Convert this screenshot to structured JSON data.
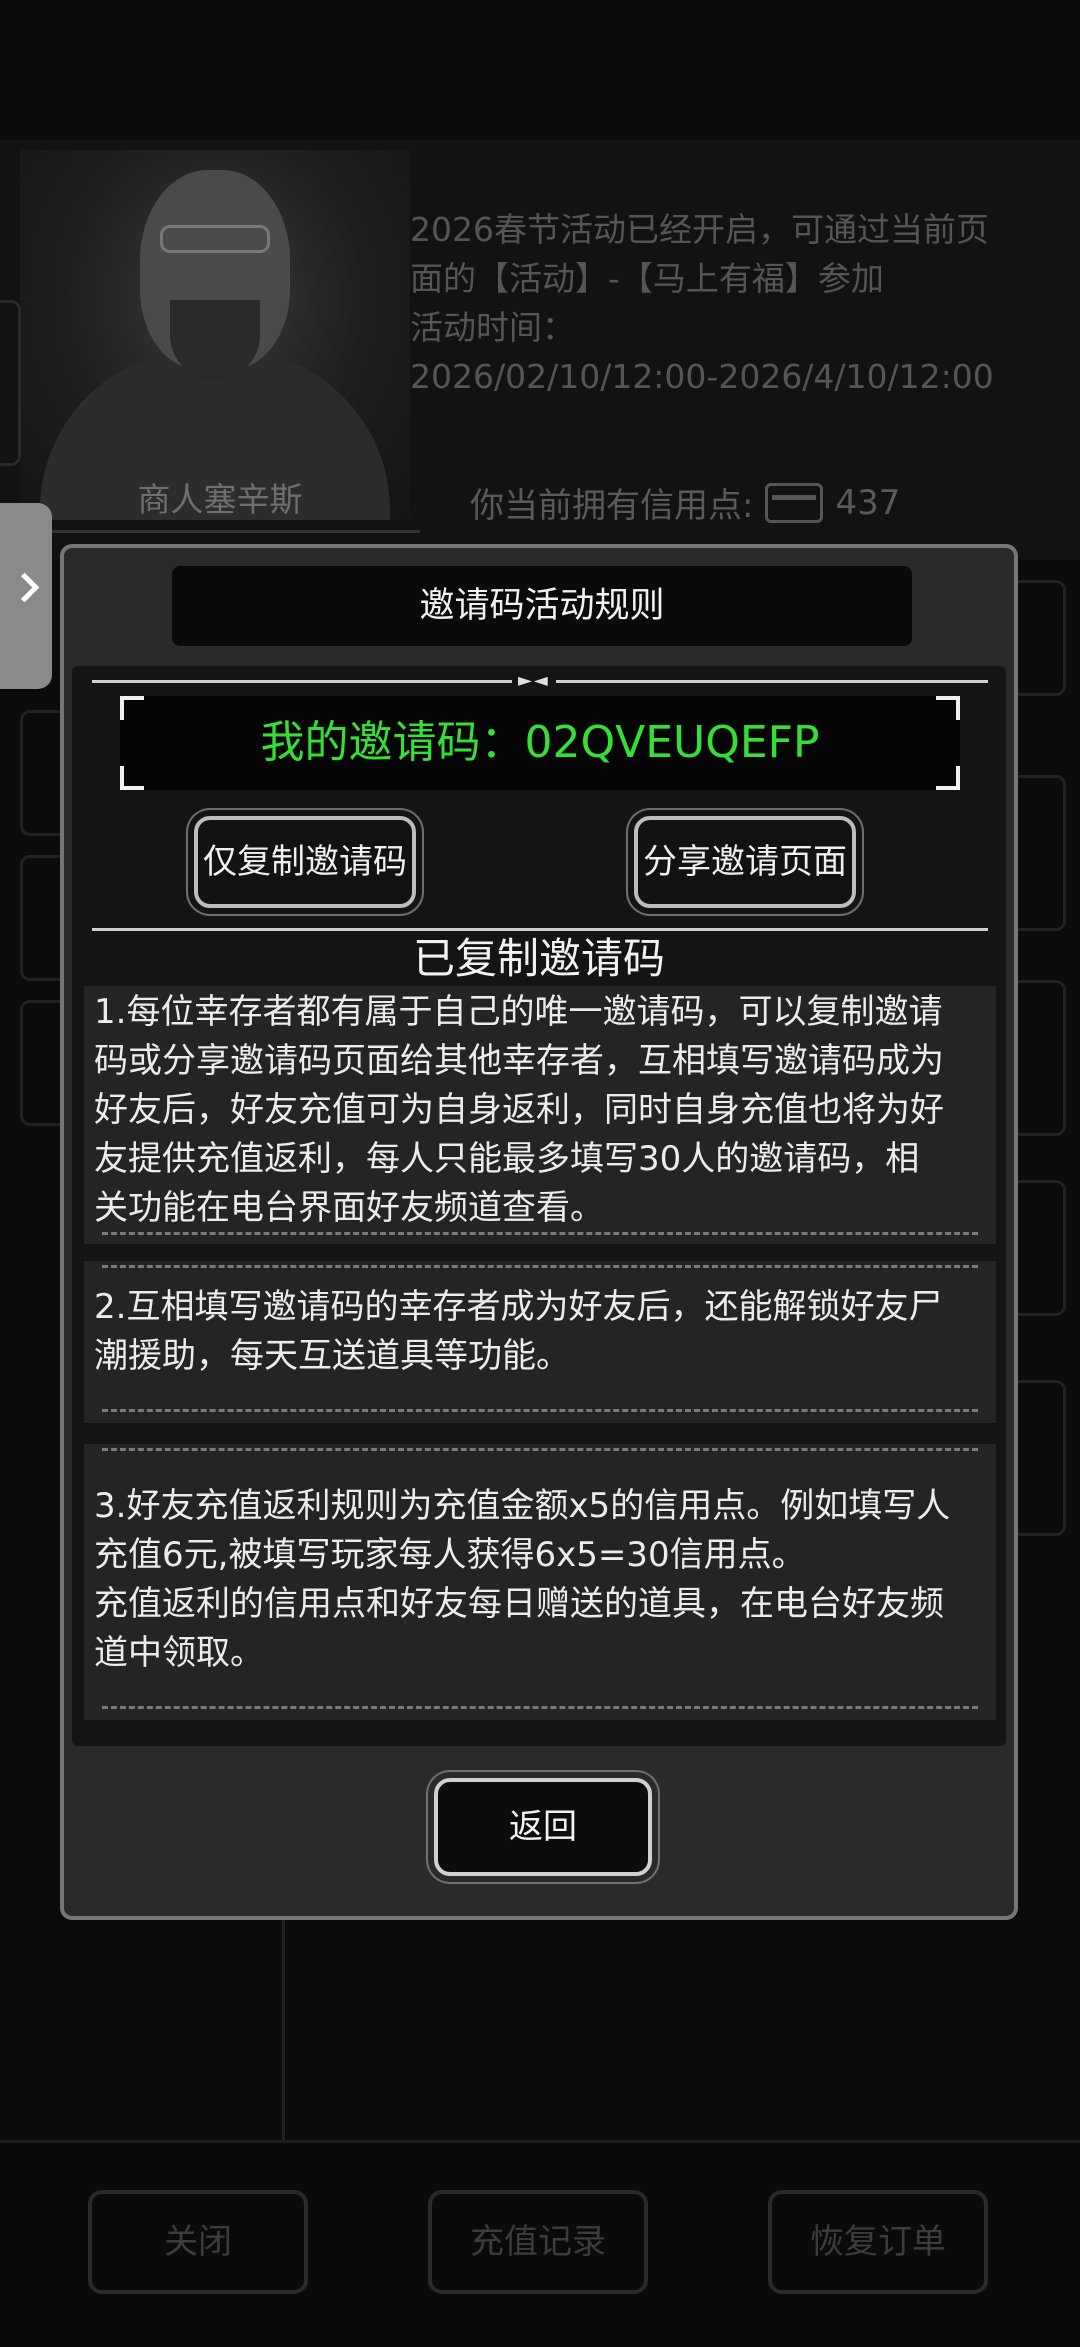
{
  "background": {
    "npc_name": "商人塞辛斯",
    "news_lines": [
      "2026春节活动已经开启，可通过当前页",
      "面的【活动】-【马上有福】参加",
      "活动时间：",
      "2026/02/10/12:00-2026/4/10/12:00"
    ],
    "credit_label": "你当前拥有信用点:",
    "credit_icon": "credit-card-icon",
    "credit_value": "437",
    "bottom_buttons": [
      "关闭",
      "充值记录",
      "恢复订单"
    ]
  },
  "modal": {
    "title": "邀请码活动规则",
    "invite_code_text": "我的邀请码：02QVEUQEFP",
    "copy_button": "仅复制邀请码",
    "share_button": "分享邀请页面",
    "status_text": "已复制邀请码",
    "rules": [
      {
        "lines": [
          "1.每位幸存者都有属于自己的唯一邀请码，可以复制邀请",
          "码或分享邀请码页面给其他幸存者，互相填写邀请码成为",
          "好友后，好友充值可为自身返利，同时自身充值也将为好",
          "友提供充值返利，每人只能最多填写30人的邀请码，相",
          "关功能在电台界面好友频道查看。"
        ]
      },
      {
        "lines": [
          "2.互相填写邀请码的幸存者成为好友后，还能解锁好友尸",
          "潮援助，每天互送道具等功能。"
        ]
      },
      {
        "lines": [
          "3.好友充值返利规则为充值金额x5的信用点。例如填写人",
          "充值6元,被填写玩家每人获得6x5=30信用点。",
          "充值返利的信用点和好友每日赠送的道具，在电台好友频",
          "道中领取。"
        ]
      }
    ],
    "back_button": "返回"
  },
  "colors": {
    "invite_code": "#34e034",
    "modal_bg": "#2a2a2a",
    "modal_border": "#767676"
  }
}
